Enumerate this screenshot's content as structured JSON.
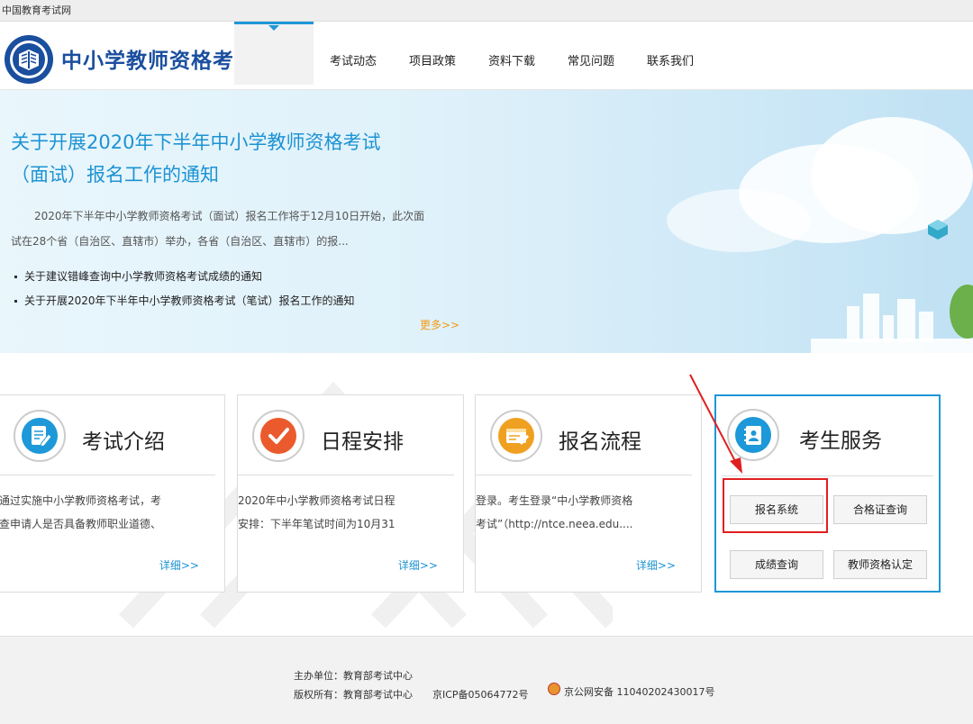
{
  "topbar": {
    "site": "中国教育考试网"
  },
  "header": {
    "title": "中小学教师资格考试",
    "nav": [
      "考试动态",
      "项目政策",
      "资料下载",
      "常见问题",
      "联系我们"
    ]
  },
  "banner": {
    "headline_line1": "关于开展2020年下半年中小学教师资格考试",
    "headline_line2": "（面试）报名工作的通知",
    "summary_line1": "2020年下半年中小学教师资格考试（面试）报名工作将于12月10日开始，此次面",
    "summary_line2": "试在28个省（自治区、直辖市）举办，各省（自治区、直辖市）的报...",
    "news": [
      "关于建议错峰查询中小学教师资格考试成绩的通知",
      "关于开展2020年下半年中小学教师资格考试（笔试）报名工作的通知"
    ],
    "more": "更多>>"
  },
  "cards": [
    {
      "title": "考试介绍",
      "icon": "document-edit-icon",
      "line1": "通过实施中小学教师资格考试，考",
      "line2": "查申请人是否具备教师职业道德、",
      "more": "详细>>"
    },
    {
      "title": "日程安排",
      "icon": "checkmark-icon",
      "line1": "2020年中小学教师资格考试日程",
      "line2": "安排：下半年笔试时间为10月31",
      "more": "详细>>"
    },
    {
      "title": "报名流程",
      "icon": "registration-form-icon",
      "line1": "登录。考生登录“中小学教师资格",
      "line2": "考试”（http://ntce.neea.edu....",
      "more": "详细>>"
    }
  ],
  "service": {
    "title": "考生服务",
    "icon": "address-book-icon",
    "buttons": [
      "报名系统",
      "合格证查询",
      "成绩查询",
      "教师资格认定"
    ]
  },
  "footer": {
    "sponsor": "主办单位：教育部考试中心",
    "copyright": "版权所有：教育部考试中心",
    "icp": "京ICP备05064772号",
    "police": "京公网安备 11040202430017号"
  },
  "colors": {
    "brand": "#1a4e9e",
    "accent": "#1d98d8",
    "more": "#f39a14",
    "highlight": "#e02020"
  }
}
